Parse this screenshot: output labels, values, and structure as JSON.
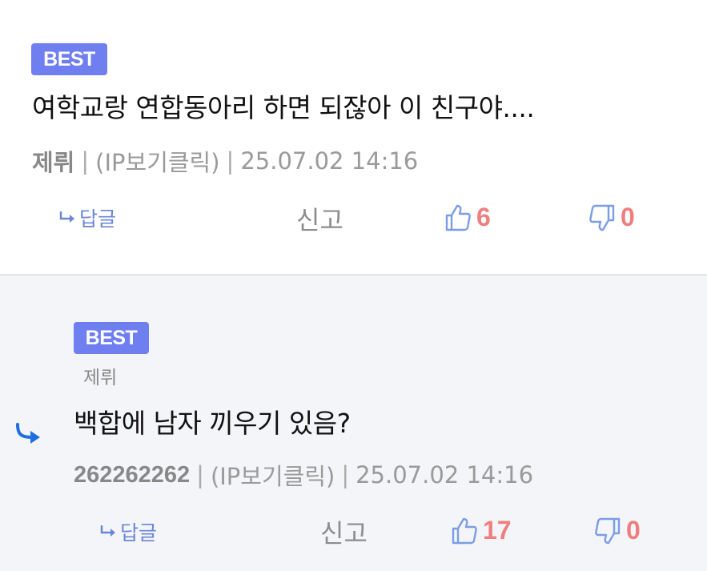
{
  "comments": [
    {
      "badge": "BEST",
      "text": "여학교랑 연합동아리 하면 되잖아 이 친구야....",
      "author": "제뤼",
      "ip_label": "(IP보기클릭)",
      "timestamp": "25.07.02 14:16",
      "reply_label": "답글",
      "report_label": "신고",
      "likes": "6",
      "dislikes": "0"
    },
    {
      "badge": "BEST",
      "reply_to": "제뤼",
      "text": "백합에 남자 끼우기 있음?",
      "author": "262262262",
      "ip_label": "(IP보기클릭)",
      "timestamp": "25.07.02 14:16",
      "reply_label": "답글",
      "report_label": "신고",
      "likes": "17",
      "dislikes": "0"
    }
  ],
  "colors": {
    "badge": "#6f7ff0",
    "count": "#f07e7e",
    "icon": "#7b9de6",
    "reply_bg": "#f4f5f8",
    "thread_arrow": "#1f6fe0"
  },
  "icons": {
    "like": "thumbs-up-icon",
    "dislike": "thumbs-down-icon",
    "reply": "reply-arrow-icon",
    "thread": "thread-reply-arrow-icon"
  }
}
